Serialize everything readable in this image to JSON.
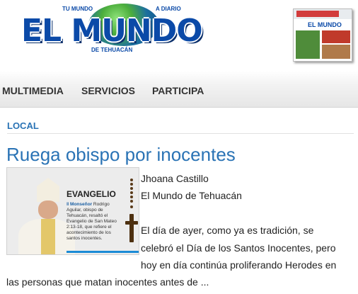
{
  "header": {
    "logo_title": "EL MUNDO",
    "logo_left_tag": "TU MUNDO",
    "logo_right_tag": "A DIARIO",
    "logo_subtitle": "DE TEHUACÁN",
    "thumbnail_title": "EL MUNDO"
  },
  "nav": {
    "items": [
      {
        "label": "MULTIMEDIA"
      },
      {
        "label": "SERVICIOS"
      },
      {
        "label": "PARTICIPA"
      }
    ]
  },
  "section": {
    "label": "LOCAL"
  },
  "article": {
    "headline": "Ruega obispo por inocentes",
    "image": {
      "heading": "EVANGELIO",
      "caption_strong": "Monseñor",
      "caption_text": "Rodrigo Aguilar, obispo de Tehuacán, resaltó el Evangelio de San Mateo 2:13-18, que refiere el acontecimiento de los santos inocentes."
    },
    "author": "Jhoana Castillo",
    "publication": "El Mundo de Tehuacán",
    "lines": [
      "El día de ayer, como ya es tradición, se",
      "celebró el Día de los Santos Inocentes, pero",
      "hoy en día continúa proliferando Herodes en",
      "las personas que matan inocentes antes de ..."
    ]
  },
  "colors": {
    "accent": "#2a73b5",
    "logo_blue": "#0b4aa8",
    "nav_text": "#333333"
  }
}
